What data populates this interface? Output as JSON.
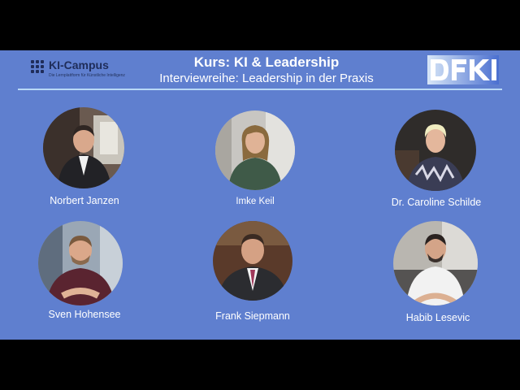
{
  "header": {
    "logo_name": "KI-Campus",
    "logo_tagline": "Die Lernplattform für Künstliche Intelligenz",
    "title": "Kurs: KI & Leadership",
    "subtitle": "Interviewreihe: Leadership in der Praxis",
    "partner_logo": "DFKI"
  },
  "colors": {
    "background": "#5f7fcf",
    "frame": "#000000",
    "rule": "#b9d9f6",
    "text": "#ffffff"
  },
  "people": [
    {
      "name": "Norbert Janzen"
    },
    {
      "name": "Imke Keil"
    },
    {
      "name": "Dr. Caroline Schilde"
    },
    {
      "name": "Sven Hohensee"
    },
    {
      "name": "Frank Siepmann"
    },
    {
      "name": "Habib Lesevic"
    }
  ]
}
